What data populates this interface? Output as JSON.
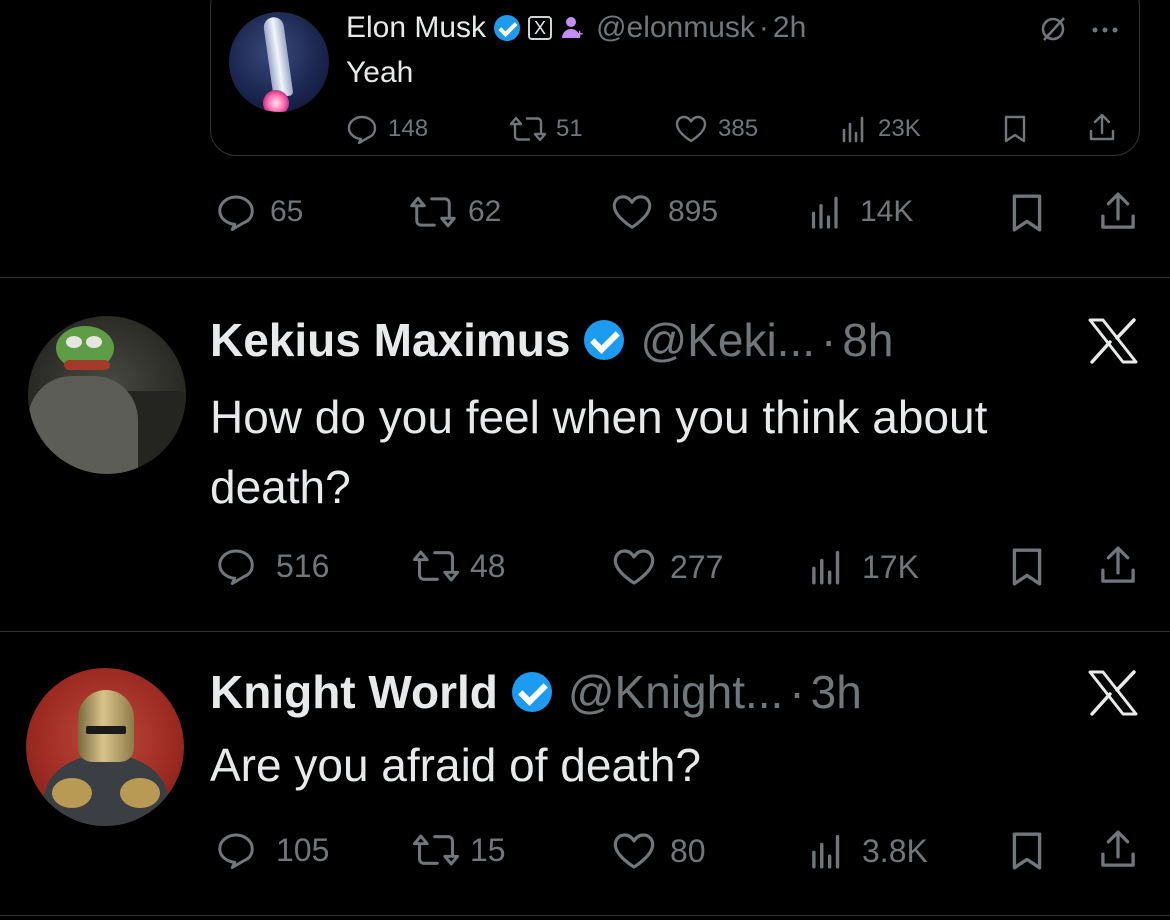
{
  "quoted_tweet": {
    "author_name": "Elon Musk",
    "x_badge": "X",
    "handle": "@elonmusk",
    "separator": "·",
    "time": "2h",
    "text": "Yeah",
    "stats": {
      "replies": "148",
      "reposts": "51",
      "likes": "385",
      "views": "23K"
    }
  },
  "parent_stats": {
    "replies": "65",
    "reposts": "62",
    "likes": "895",
    "views": "14K"
  },
  "tweets": [
    {
      "author_name": "Kekius Maximus",
      "handle": "@Keki...",
      "separator": "·",
      "time": "8h",
      "text_line1": "How do you feel when you think about",
      "text_line2": "death?",
      "stats": {
        "replies": "516",
        "reposts": "48",
        "likes": "277",
        "views": "17K"
      }
    },
    {
      "author_name": "Knight World",
      "handle": "@Knight...",
      "separator": "·",
      "time": "3h",
      "text_line1": "Are you afraid of death?",
      "stats": {
        "replies": "105",
        "reposts": "15",
        "likes": "80",
        "views": "3.8K"
      }
    }
  ],
  "colors": {
    "background": "#000000",
    "text": "#e7e9ea",
    "muted": "#71767b",
    "verified": "#1d9bf0",
    "divider": "#2f3336"
  },
  "icons": [
    "reply-icon",
    "repost-icon",
    "like-icon",
    "views-icon",
    "bookmark-icon",
    "share-icon",
    "grok-icon",
    "more-icon",
    "x-logo-icon",
    "verified-icon",
    "affiliate-icon"
  ]
}
